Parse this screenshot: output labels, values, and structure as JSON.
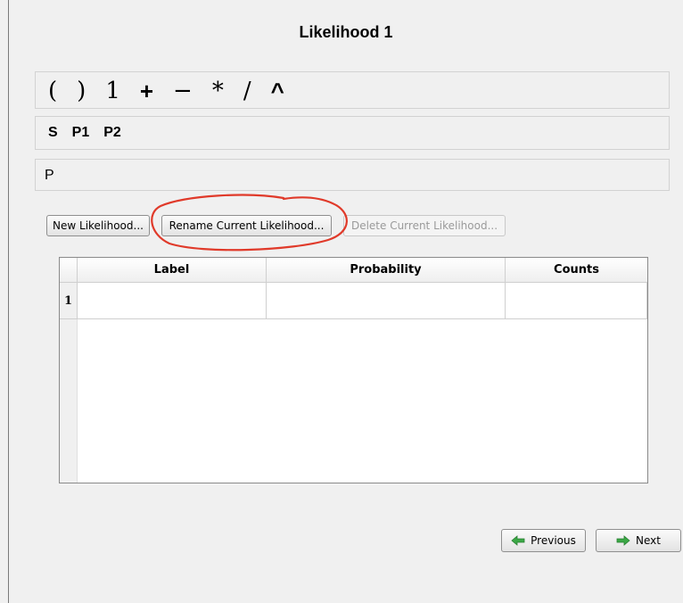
{
  "title": "Likelihood 1",
  "operators": [
    "(",
    ")",
    "1",
    "+",
    "−",
    "*",
    "/",
    "^"
  ],
  "variables": [
    "S",
    "P1",
    "P2"
  ],
  "expression": "P",
  "buttons": {
    "new": "New Likelihood...",
    "rename": "Rename Current Likelihood...",
    "delete": "Delete Current Likelihood..."
  },
  "table": {
    "headers": [
      "Label",
      "Probability",
      "Counts"
    ],
    "rows": [
      {
        "num": "1",
        "label": "",
        "probability": "",
        "counts": ""
      }
    ]
  },
  "nav": {
    "previous": "Previous",
    "next": "Next"
  },
  "colors": {
    "annotation": "#e03a2a",
    "arrow_green": "#3aa845"
  }
}
